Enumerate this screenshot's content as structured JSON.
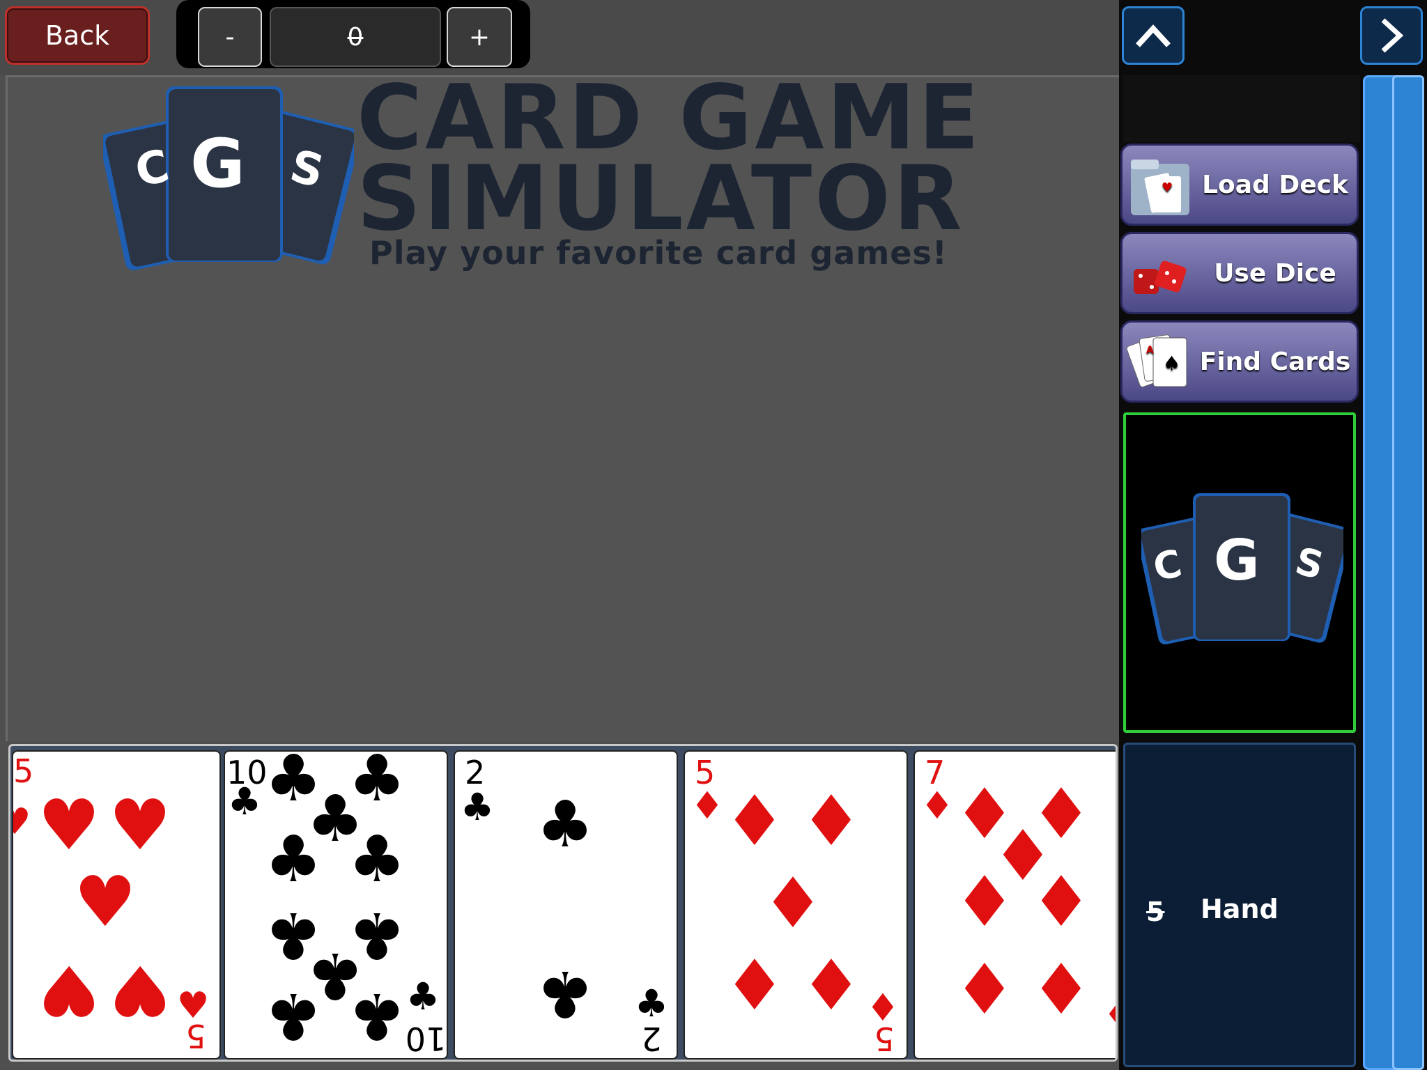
{
  "topbar": {
    "back_label": "Back",
    "counter": {
      "minus": "-",
      "value": "0",
      "plus": "+"
    }
  },
  "logo": {
    "letters": [
      "C",
      "G",
      "S"
    ],
    "title_line1": "CARD GAME",
    "title_line2": "SIMULATOR",
    "subtitle": "Play your favorite card games!"
  },
  "sidebar": {
    "menu": [
      {
        "label": "Load Deck",
        "icon": "folder-cards-icon"
      },
      {
        "label": "Use Dice",
        "icon": "dice-icon"
      },
      {
        "label": "Find Cards",
        "icon": "playing-cards-icon"
      }
    ],
    "preview_letters": [
      "C",
      "G",
      "S"
    ],
    "hand_count": "5",
    "hand_label": "Hand"
  },
  "hand": {
    "cards": [
      {
        "rank": "5",
        "suit": "hearts",
        "pip": "♥",
        "color": "#e01010"
      },
      {
        "rank": "10",
        "suit": "clubs",
        "pip": "♣",
        "color": "#000000"
      },
      {
        "rank": "2",
        "suit": "clubs",
        "pip": "♣",
        "color": "#000000"
      },
      {
        "rank": "5",
        "suit": "diamonds",
        "pip": "♦",
        "color": "#e01010"
      },
      {
        "rank": "7",
        "suit": "diamonds",
        "pip": "♦",
        "color": "#e01010"
      }
    ]
  },
  "colors": {
    "accent_blue": "#2d84d4",
    "preview_border": "#2fcf3c",
    "back_border": "#c0302a",
    "logo_dark": "#1d2533"
  }
}
